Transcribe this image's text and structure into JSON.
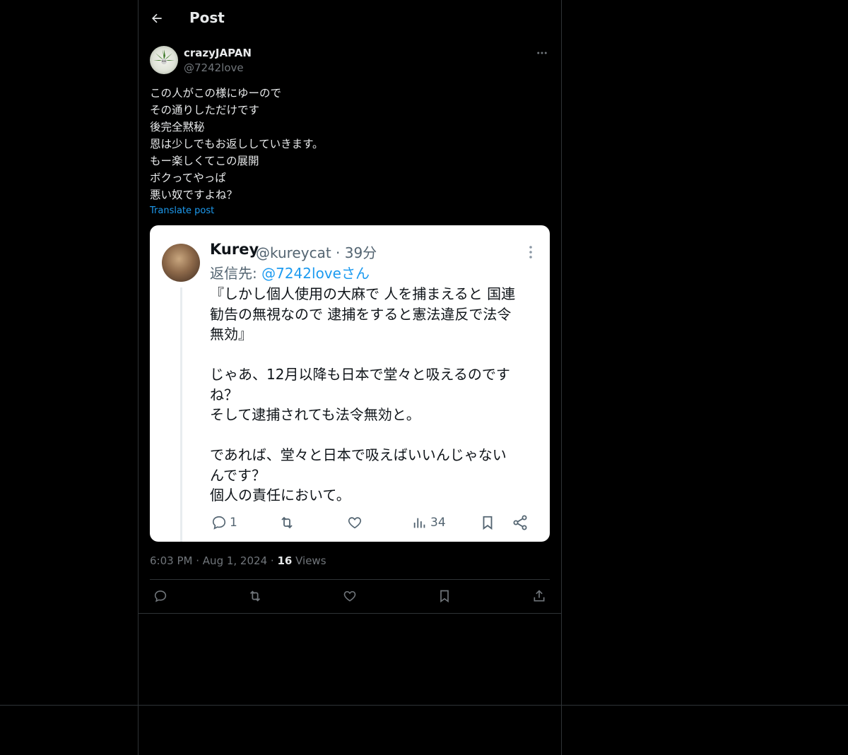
{
  "header": {
    "title": "Post"
  },
  "author": {
    "display_name": "crazyJAPAN",
    "handle": "@7242love"
  },
  "post": {
    "lines": [
      "この人がこの様にゆーので",
      "その通りしただけです",
      "後完全黙秘",
      "恩は少しでもお返ししていきます。",
      "もー楽しくてこの展開",
      "ボクってやっぱ",
      "悪い奴ですよね？"
    ],
    "translate_label": "Translate post"
  },
  "embedded": {
    "name": "Kurey",
    "meta": "@kureycat · 39分",
    "reply_prefix": "返信先: ",
    "reply_mention": "@7242loveさん",
    "paragraph1": [
      "『しかし個人使用の大麻で 人を捕まえると 国連",
      "勧告の無視なので 逮捕をすると憲法違反で法令",
      "無効』"
    ],
    "paragraph2": [
      "じゃあ、12月以降も日本で堂々と吸えるのです",
      "ね？",
      "そして逮捕されても法令無効と。"
    ],
    "paragraph3": [
      "であれば、堂々と日本で吸えばいいんじゃない",
      "んです？",
      "個人の責任において。"
    ],
    "reply_count": "1",
    "views_count": "34"
  },
  "meta": {
    "time": "6:03 PM",
    "separator": "·",
    "date": "Aug 1, 2024",
    "views_count": "16",
    "views_label": "Views"
  },
  "icons": {
    "back": "arrow-left-icon",
    "more": "more-horizontal-icon",
    "reply": "reply-icon",
    "repost": "repost-icon",
    "like": "heart-icon",
    "bookmark": "bookmark-icon",
    "share": "share-icon"
  },
  "colors": {
    "accent": "#1d9bf0",
    "muted": "#71767b",
    "text": "#e7e9ea",
    "border": "#2f3336"
  }
}
